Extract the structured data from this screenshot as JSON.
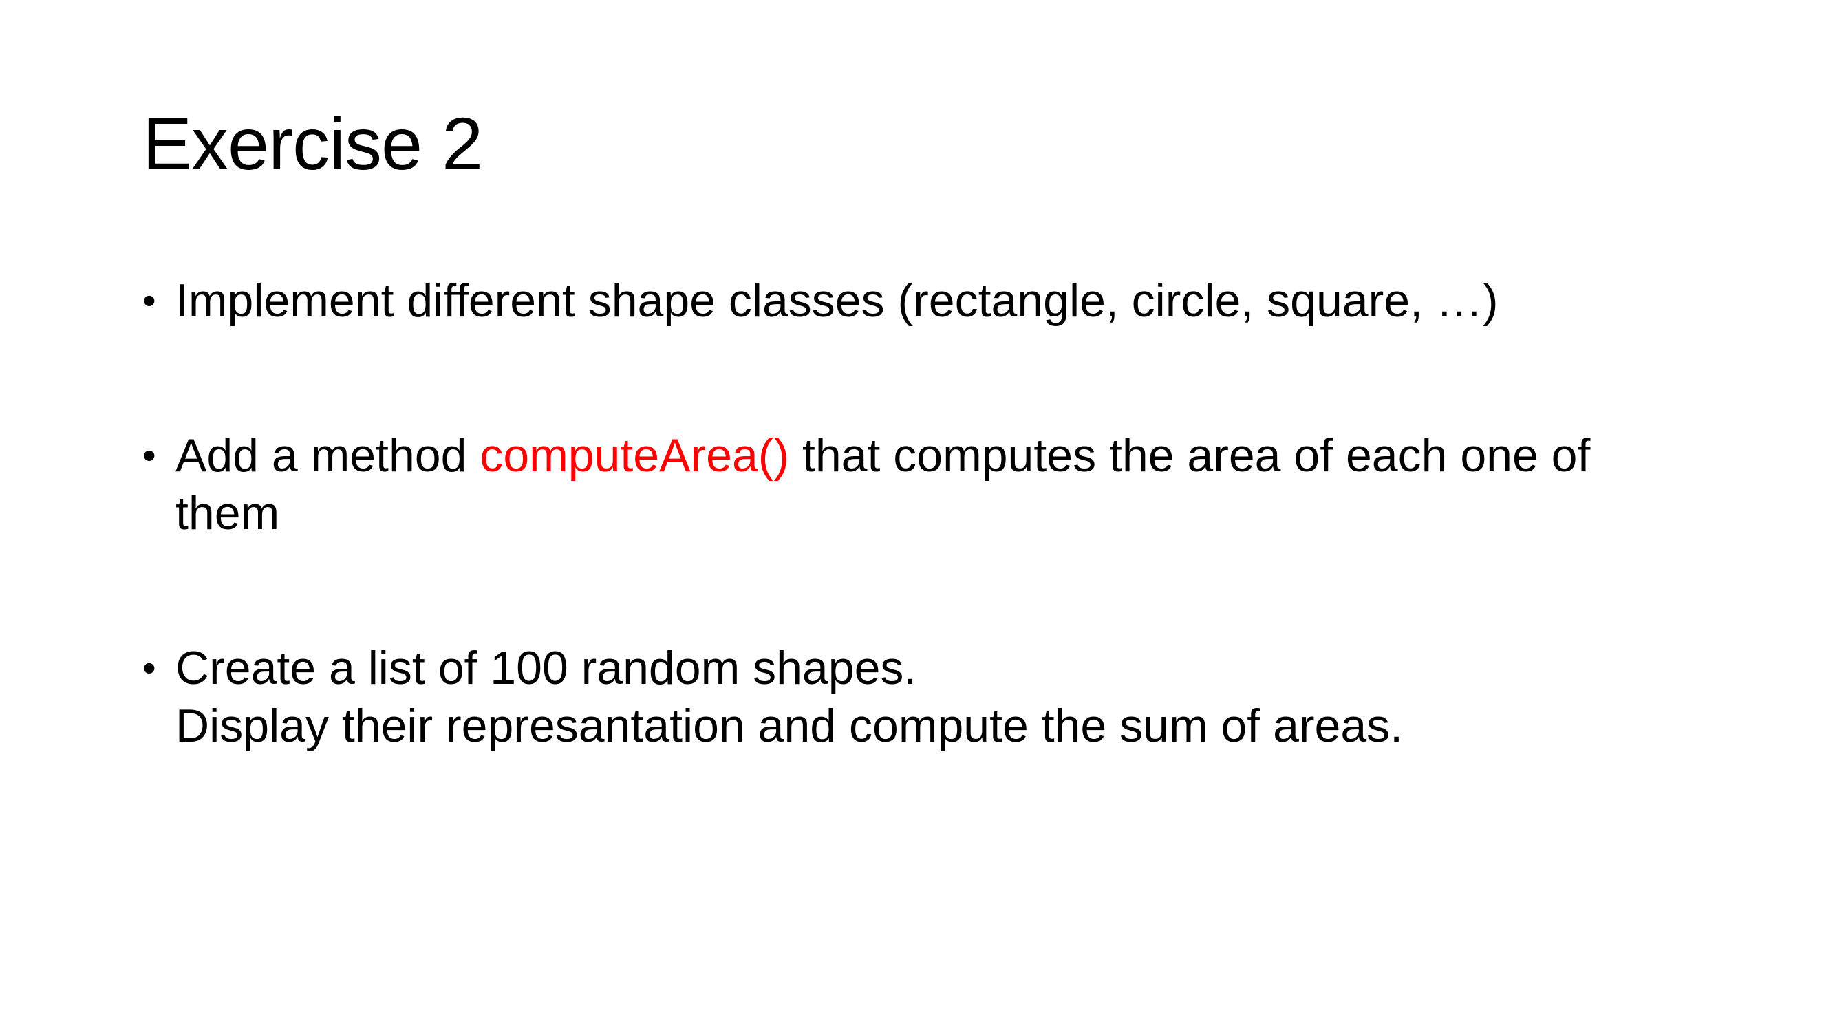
{
  "slide": {
    "title": "Exercise 2",
    "bullet_symbol": "•",
    "bullets": [
      {
        "text": "Implement different shape classes (rectangle, circle, square, …)"
      },
      {
        "before": "Add a method ",
        "highlight": "computeArea()",
        "after": " that computes the area of each one of",
        "line2": "them"
      },
      {
        "line1": "Create a list of 100 random shapes.",
        "line2": "Display their represantation and compute the sum of areas."
      }
    ],
    "colors": {
      "text": "#000000",
      "highlight": "#ff0000",
      "background": "#ffffff"
    }
  }
}
